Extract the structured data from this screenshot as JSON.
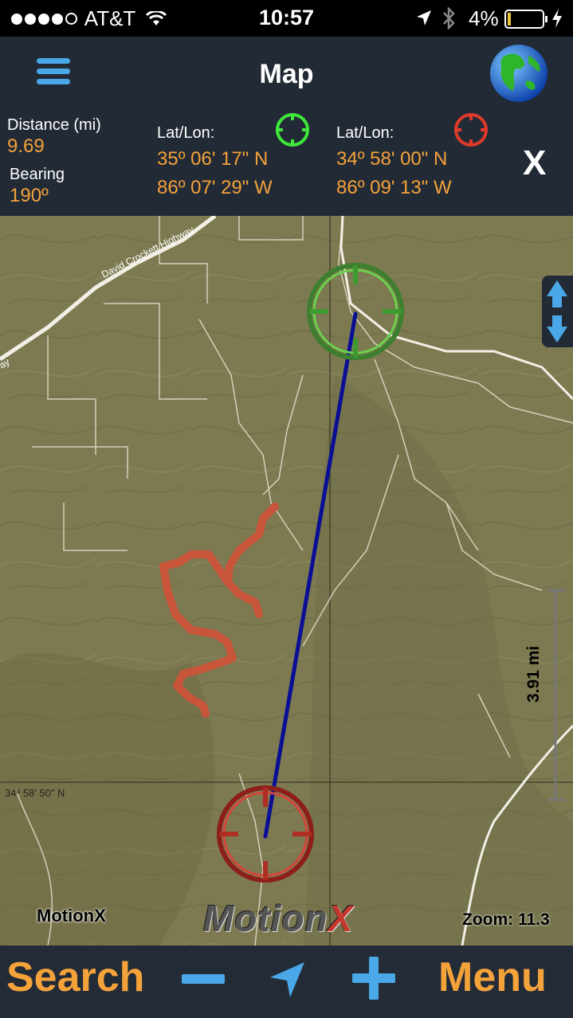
{
  "status_bar": {
    "carrier": "AT&T",
    "time": "10:57",
    "battery": "4%"
  },
  "header": {
    "title": "Map",
    "distance_label": "Distance (mi)",
    "distance_value": "9.69",
    "bearing_label": "Bearing",
    "bearing_value": "190º",
    "start": {
      "label": "Lat/Lon:",
      "lat": "35º 06' 17\" N",
      "lon": "86º 07' 29\" W",
      "color": "#3ee83a"
    },
    "end": {
      "label": "Lat/Lon:",
      "lat": "34º 58' 00\" N",
      "lon": "86º 09' 13\" W",
      "color": "#e03a2a"
    },
    "close_label": "X"
  },
  "map": {
    "road_label": "David Crockett Highway",
    "road_label_short": "ay",
    "latitude_label": "34º 58' 50\" N",
    "scale_label": "3.91 mi",
    "brand_small": "MotionX",
    "brand_large_prefix": "Motion",
    "brand_large_suffix": "X",
    "zoom_label": "Zoom: 11.3",
    "line_color": "#0a0f96",
    "track_color": "#c8553a"
  },
  "toolbar": {
    "search_label": "Search",
    "menu_label": "Menu",
    "accent": "#f4a23a",
    "icon_color": "#4aa8e8"
  }
}
